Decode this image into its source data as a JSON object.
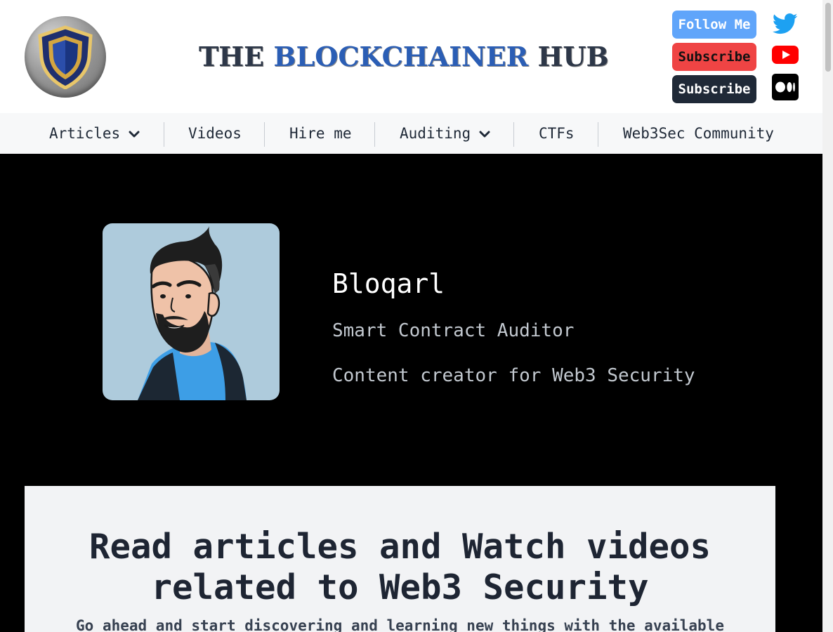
{
  "header": {
    "title_part1": "THE ",
    "title_part2": "BLOCKCHAINER",
    "title_part3": " HUB",
    "buttons": {
      "follow_label": "Follow Me",
      "youtube_label": "Subscribe",
      "medium_label": "Subscribe"
    },
    "icons": {
      "logo": "shield-logo-icon",
      "twitter": "twitter-icon",
      "youtube": "youtube-icon",
      "medium": "medium-icon"
    }
  },
  "nav": {
    "items": [
      {
        "label": "Articles",
        "has_dropdown": true
      },
      {
        "label": "Videos",
        "has_dropdown": false
      },
      {
        "label": "Hire me",
        "has_dropdown": false
      },
      {
        "label": "Auditing",
        "has_dropdown": true
      },
      {
        "label": "CTFs",
        "has_dropdown": false
      },
      {
        "label": "Web3Sec Community",
        "has_dropdown": false
      }
    ]
  },
  "hero": {
    "name": "Bloqarl",
    "role": "Smart Contract Auditor",
    "description": "Content creator for Web3 Security"
  },
  "content": {
    "heading_line1": "Read articles and Watch videos",
    "heading_line2": "related to Web3 Security",
    "subtext": "Go ahead and start discovering and learning new things with the available"
  },
  "colors": {
    "follow_button": "#60a5fa",
    "youtube_button": "#ef4444",
    "medium_button": "#1f2937",
    "title_accent": "#2b5eb5",
    "hero_background": "#000000"
  }
}
